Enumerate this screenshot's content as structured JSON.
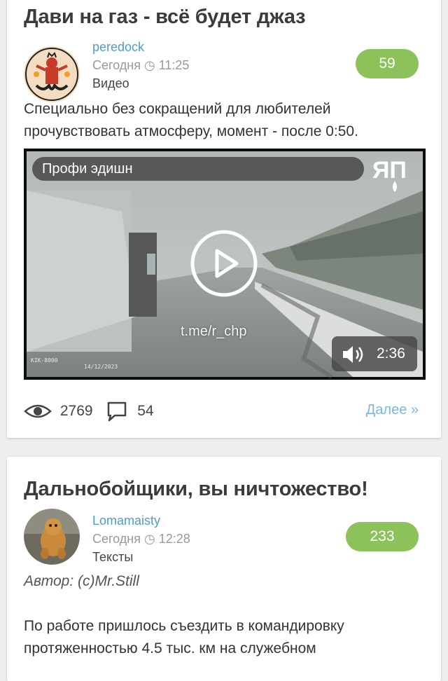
{
  "posts": [
    {
      "title": "Дави на газ - всё будет джаз",
      "author": "peredock",
      "time": "Сегодня ◷ 11:25",
      "category": "Видео",
      "rating": "59",
      "text": "Специально без сокращений для любителей прочувствовать атмосферу, момент - после 0:50.",
      "video": {
        "title": "Профи эдишн",
        "logo": "ЯП",
        "watermark": "t.me/r_chp",
        "duration": "2:36",
        "timestamp_overlay": "14/12/2023"
      },
      "views": "2769",
      "comments": "54",
      "more_label": "Далее »"
    },
    {
      "title": "Дальнобойщики, вы ничтожество!",
      "author": "Lomamaisty",
      "time": "Сегодня ◷ 12:28",
      "category": "Тексты",
      "rating": "233",
      "byline": "Автор: (с)Mr.Still",
      "text": "По работе пришлось съездить в командировку протяженностью 4.5 тыс. км на служебном"
    }
  ],
  "colors": {
    "rating_bg": "#8dc15a",
    "author_link": "#4a9fc8",
    "more_link": "#7ab9de"
  }
}
